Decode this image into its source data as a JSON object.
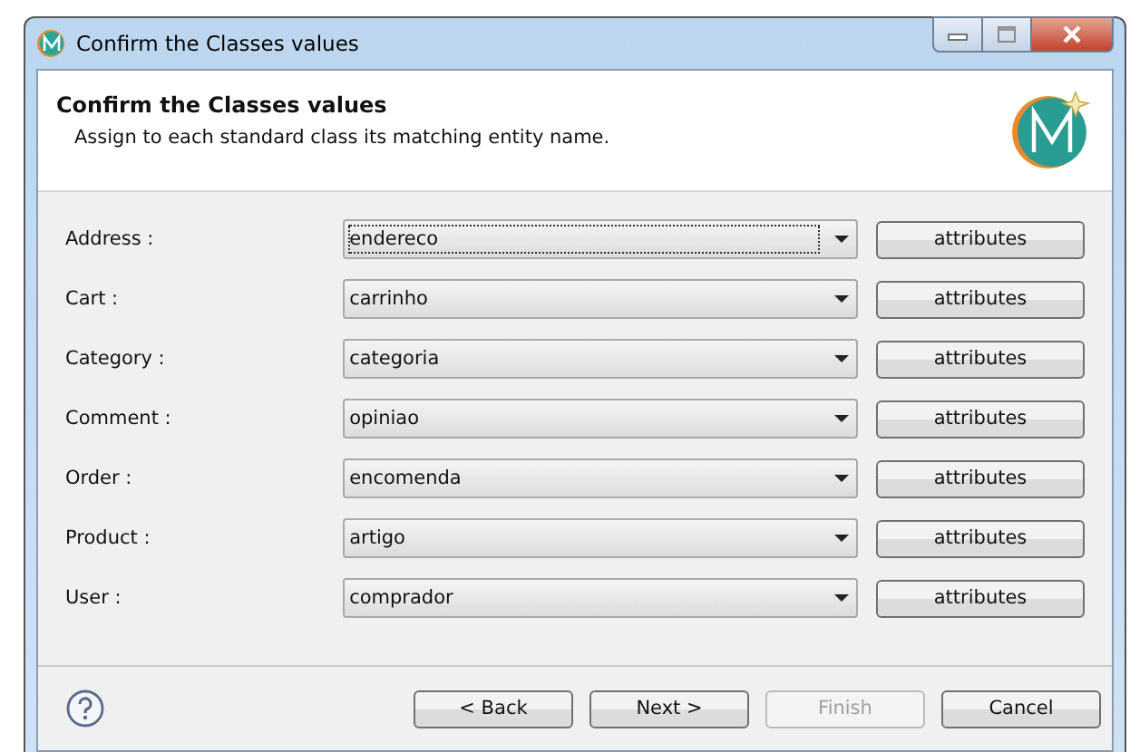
{
  "window": {
    "title": "Confirm the Classes values"
  },
  "header": {
    "title": "Confirm the Classes values",
    "description": "Assign to each standard class its matching entity name."
  },
  "mappings": [
    {
      "label": "Address :",
      "value": "endereco",
      "focused": true,
      "button": "attributes"
    },
    {
      "label": "Cart :",
      "value": "carrinho",
      "focused": false,
      "button": "attributes"
    },
    {
      "label": "Category :",
      "value": "categoria",
      "focused": false,
      "button": "attributes"
    },
    {
      "label": "Comment :",
      "value": "opiniao",
      "focused": false,
      "button": "attributes"
    },
    {
      "label": "Order :",
      "value": "encomenda",
      "focused": false,
      "button": "attributes"
    },
    {
      "label": "Product :",
      "value": "artigo",
      "focused": false,
      "button": "attributes"
    },
    {
      "label": "User :",
      "value": "comprador",
      "focused": false,
      "button": "attributes"
    }
  ],
  "buttons": [
    {
      "label": "< Back",
      "disabled": false
    },
    {
      "label": "Next >",
      "disabled": false
    },
    {
      "label": "Finish",
      "disabled": true
    },
    {
      "label": "Cancel",
      "disabled": false
    }
  ]
}
